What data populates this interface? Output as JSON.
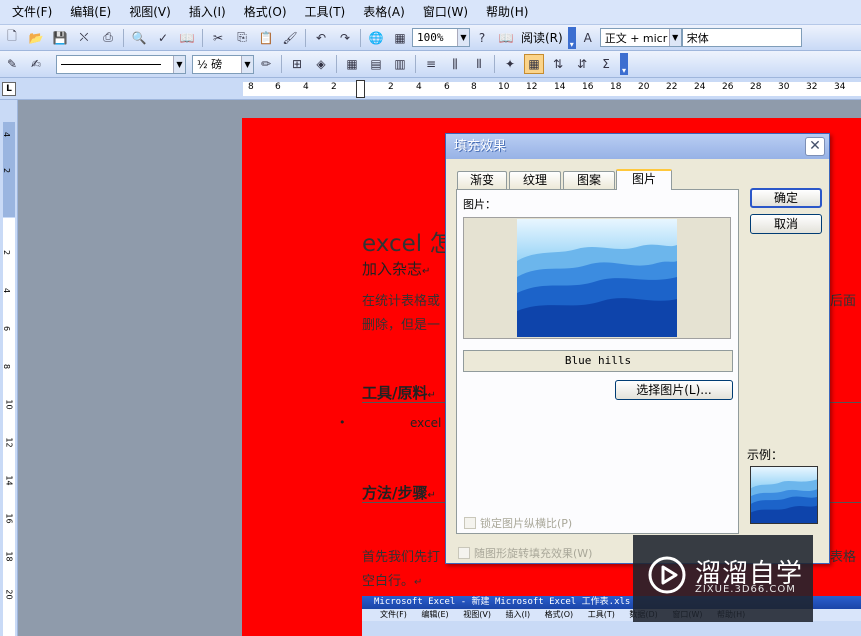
{
  "menu": [
    "文件(F)",
    "编辑(E)",
    "视图(V)",
    "插入(I)",
    "格式(O)",
    "工具(T)",
    "表格(A)",
    "窗口(W)",
    "帮助(H)"
  ],
  "toolbar1": {
    "zoom": "100%",
    "read_label": "阅读(R)",
    "style": "正文 + micr",
    "font": "宋体"
  },
  "toolbar2": {
    "line_weight": "½ 磅"
  },
  "ruler": {
    "h_numbers": [
      "8",
      "6",
      "4",
      "2",
      "2",
      "4",
      "6",
      "8",
      "10",
      "12",
      "14",
      "16",
      "18",
      "20",
      "22",
      "24",
      "26",
      "28",
      "30",
      "32",
      "34"
    ],
    "v_numbers": [
      "4",
      "2",
      "2",
      "4",
      "6",
      "8",
      "10",
      "12",
      "14",
      "16",
      "18",
      "20"
    ]
  },
  "document": {
    "title": "excel 怎",
    "subtitle": "加入杂志",
    "p1": "在统计表格或",
    "p1_right": "后面",
    "p2": "删除，但是一",
    "heading1": "工具/原料",
    "tool_item": "excel",
    "heading2": "方法/步骤",
    "p3": "首先我们先打",
    "p3_right": "表格",
    "p4": "空白行。",
    "para_mark": "↵",
    "bullet": "•",
    "embed": {
      "title": "Microsoft Excel - 新建 Microsoft Excel 工作表.xls",
      "menu": "文件(F) 编辑(E) 视图(V) 插入(I) 格式(O) 工具(T) 数据(D) 窗口(W) 帮助(H)"
    }
  },
  "dialog": {
    "title": "填充效果",
    "close": "✕",
    "tabs": [
      "渐变",
      "纹理",
      "图案",
      "图片"
    ],
    "selected_tab": "图片",
    "picture_label": "图片：",
    "picture_name": "Blue hills",
    "select_button": "选择图片(L)...",
    "ok_button": "确定",
    "cancel_button": "取消",
    "lock_aspect": "锁定图片纵横比(P)",
    "rotate_fill": "随图形旋转填充效果(W)",
    "sample_label": "示例："
  },
  "watermark": {
    "text": "溜溜自学",
    "url": "ZIXUE.3D66.COM"
  },
  "colors": {
    "page_background": "#ff0000",
    "dialog_background": "#ece9d8",
    "dialog_titlebar": "#a8bfec"
  }
}
